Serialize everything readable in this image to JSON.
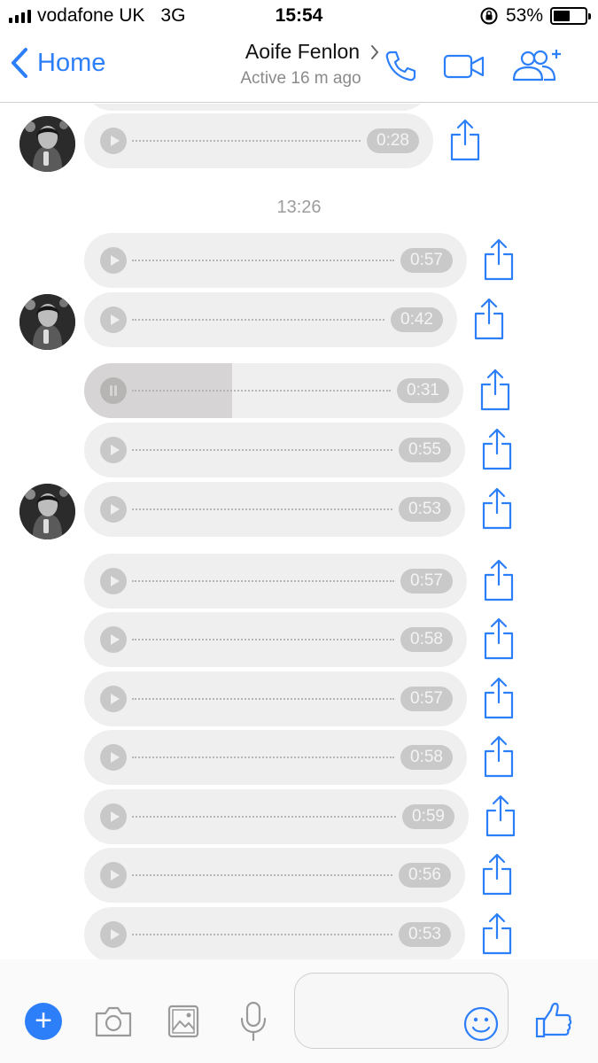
{
  "status_bar": {
    "carrier": "vodafone UK",
    "network": "3G",
    "time": "15:54",
    "battery_percent": "53%",
    "battery_level": 0.53
  },
  "nav": {
    "back_label": "Home",
    "contact_name": "Aoife Fenlon",
    "contact_status": "Active 16 m ago"
  },
  "chat": {
    "timestamp": "13:26",
    "messages": [
      {
        "duration": "0:28",
        "playing": false,
        "progress": 0
      },
      {
        "duration": "0:57",
        "playing": false,
        "progress": 0
      },
      {
        "duration": "0:42",
        "playing": false,
        "progress": 0
      },
      {
        "duration": "0:31",
        "playing": true,
        "progress": 0.39
      },
      {
        "duration": "0:55",
        "playing": false,
        "progress": 0
      },
      {
        "duration": "0:53",
        "playing": false,
        "progress": 0
      },
      {
        "duration": "0:57",
        "playing": false,
        "progress": 0
      },
      {
        "duration": "0:58",
        "playing": false,
        "progress": 0
      },
      {
        "duration": "0:57",
        "playing": false,
        "progress": 0
      },
      {
        "duration": "0:58",
        "playing": false,
        "progress": 0
      },
      {
        "duration": "0:59",
        "playing": false,
        "progress": 0
      },
      {
        "duration": "0:56",
        "playing": false,
        "progress": 0
      },
      {
        "duration": "0:53",
        "playing": false,
        "progress": 0
      }
    ]
  },
  "colors": {
    "accent": "#2d7ff9",
    "bubble": "#efefef",
    "progress": "#d6d4d4"
  },
  "icons": {
    "back": "chevron-left-icon",
    "call": "phone-icon",
    "video": "video-camera-icon",
    "add_people": "add-people-icon",
    "share": "share-icon",
    "plus": "plus-icon",
    "camera": "camera-icon",
    "photo": "photo-icon",
    "mic": "microphone-icon",
    "emoji": "emoji-icon",
    "like": "thumbs-up-icon"
  }
}
